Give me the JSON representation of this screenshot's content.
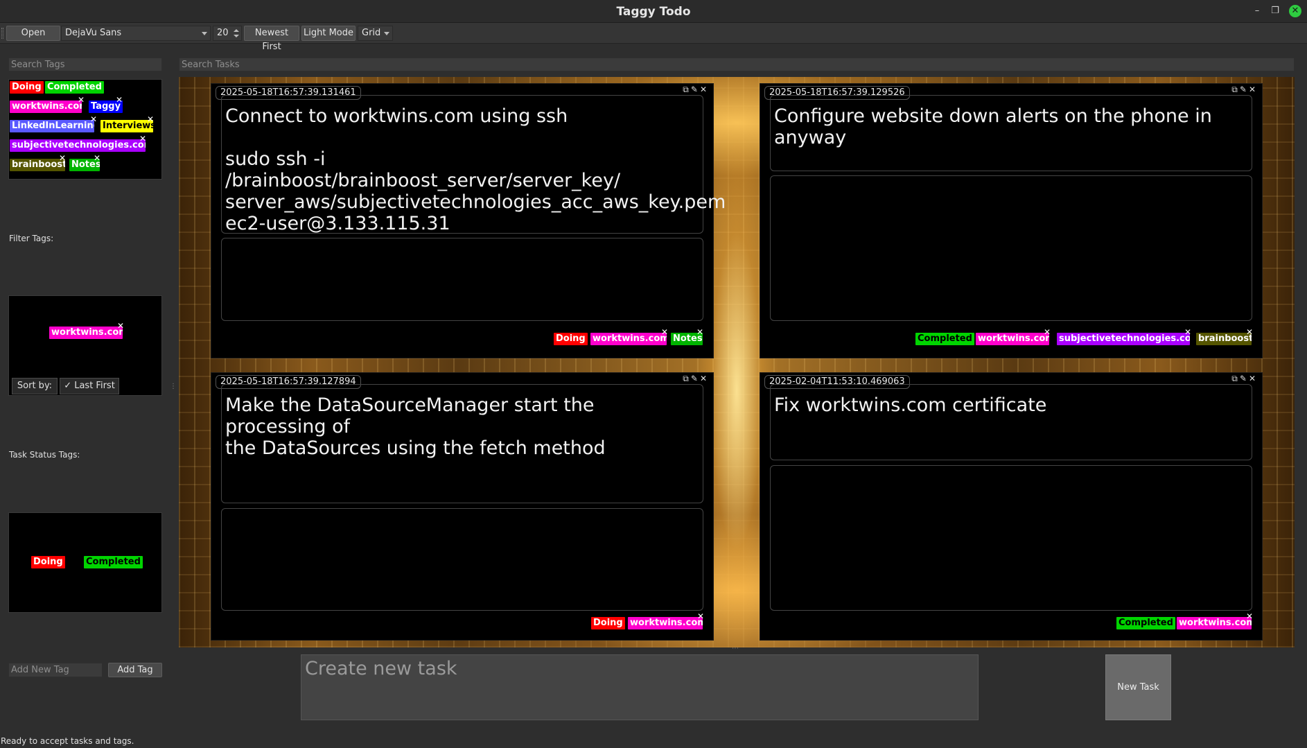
{
  "window": {
    "title": "Taggy  Todo"
  },
  "toolbar": {
    "open_label": "Open",
    "font_value": "DejaVu Sans",
    "size_value": "20",
    "order_label": "Newest First",
    "theme_label": "Light Mode",
    "view_value": "Grid"
  },
  "sidebar": {
    "search_tags_placeholder": "Search Tags",
    "filter_label": "Filter Tags:",
    "sort_label": "Sort by:",
    "sort_value": "Last First",
    "status_label": "Task Status Tags:",
    "add_tag_placeholder": "Add New Tag",
    "add_tag_button": "Add Tag",
    "tags": [
      {
        "label": "Doing",
        "bg": "#ff0000",
        "fg": "#ffffff"
      },
      {
        "label": "Completed",
        "bg": "#00d400",
        "fg": "#ffffff"
      },
      {
        "label": "worktwins.com",
        "bg": "#ff00cc",
        "fg": "#ffffff"
      },
      {
        "label": "Taggy",
        "bg": "#0000ff",
        "fg": "#ffffff"
      },
      {
        "label": "LinkedInLearning",
        "bg": "#5a5aff",
        "fg": "#ffffff"
      },
      {
        "label": "Interviews",
        "bg": "#ffff00",
        "fg": "#000000"
      },
      {
        "label": "subjectivetechnologies.com",
        "bg": "#aa00ff",
        "fg": "#ffffff"
      },
      {
        "label": "brainboost",
        "bg": "#555500",
        "fg": "#ffffff"
      },
      {
        "label": "Notes",
        "bg": "#00b400",
        "fg": "#ffffff"
      }
    ],
    "filter_tags": [
      {
        "label": "worktwins.com",
        "bg": "#ff00cc",
        "fg": "#ffffff"
      }
    ],
    "status_tags": [
      {
        "label": "Doing",
        "bg": "#ff0000",
        "fg": "#ffffff"
      },
      {
        "label": "Completed",
        "bg": "#00d400",
        "fg": "#000000"
      }
    ]
  },
  "main": {
    "search_tasks_placeholder": "Search Tasks",
    "tasks": [
      {
        "timestamp": "2025-05-18T16:57:39.131461",
        "text": "Connect to worktwins.com using ssh\n\nsudo ssh -i /brainboost/brainboost_server/server_key/\nserver_aws/subjectivetechnologies_acc_aws_key.pem\nec2-user@3.133.115.31",
        "tags": [
          "Doing",
          "worktwins.com",
          "Notes"
        ]
      },
      {
        "timestamp": "2025-05-18T16:57:39.129526",
        "text": "Configure website down alerts on the phone in anyway",
        "tags": [
          "Completed",
          "worktwins.com",
          "subjectivetechnologies.com",
          "brainboost"
        ]
      },
      {
        "timestamp": "2025-05-18T16:57:39.127894",
        "text": "Make the DataSourceManager start the processing of\nthe DataSources using the fetch method",
        "tags": [
          "Doing",
          "worktwins.com"
        ]
      },
      {
        "timestamp": "2025-02-04T11:53:10.469063",
        "text": "Fix worktwins.com certificate",
        "tags": [
          "Completed",
          "worktwins.com"
        ]
      }
    ]
  },
  "bottom": {
    "new_task_placeholder": "Create new task",
    "new_task_button": "New Task"
  },
  "status_bar": {
    "text": "Ready to accept tasks and tags."
  }
}
